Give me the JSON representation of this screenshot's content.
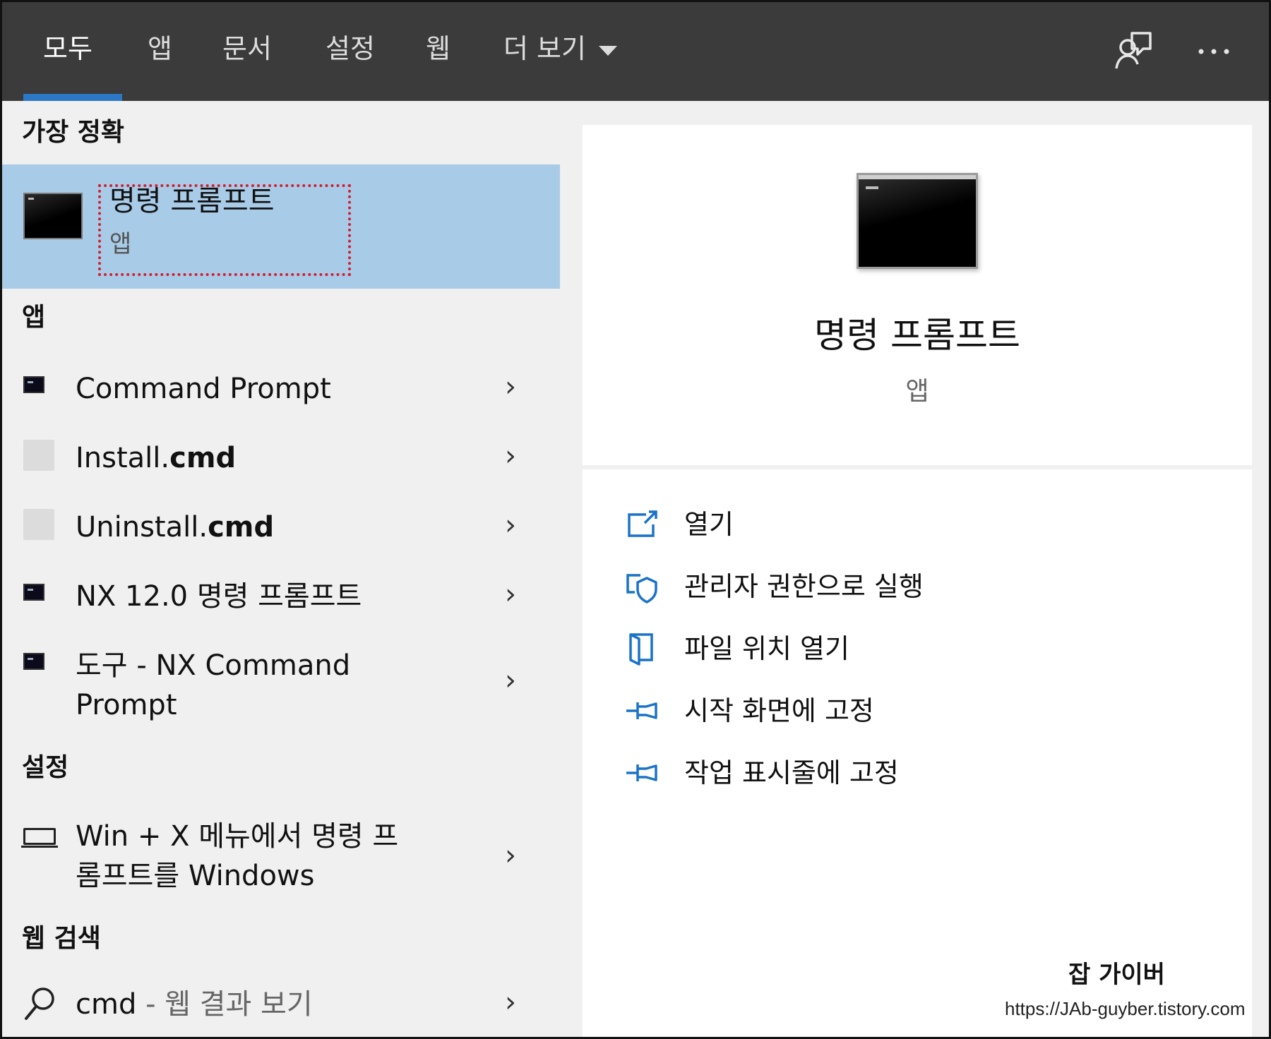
{
  "tabs": [
    {
      "label": "모두",
      "active": true
    },
    {
      "label": "앱"
    },
    {
      "label": "문서"
    },
    {
      "label": "설정"
    },
    {
      "label": "웹"
    },
    {
      "label": "더 보기"
    }
  ],
  "top_icons": [
    "feedback-icon",
    "more-icon"
  ],
  "sections": {
    "best_match": "가장 정확",
    "apps": "앱",
    "settings": "설정",
    "web_search": "웹 검색"
  },
  "best_match": {
    "title": "명령 프롬프트",
    "type": "앱"
  },
  "apps": [
    {
      "label": "Command Prompt",
      "icon": "command-prompt-icon"
    },
    {
      "label_pre": "Install.",
      "label_bold": "cmd",
      "icon": "blank-file-icon"
    },
    {
      "label_pre": "Uninstall.",
      "label_bold": "cmd",
      "icon": "blank-file-icon"
    },
    {
      "label": "NX 12.0 명령 프롬프트",
      "icon": "command-prompt-icon"
    },
    {
      "label_line1": "도구 - NX Command",
      "label_line2": "Prompt",
      "icon": "command-prompt-icon"
    }
  ],
  "settings_items": [
    {
      "label_line1": "Win + X 메뉴에서 명령 프",
      "label_line2": "롬프트를 Windows",
      "icon": "laptop-icon"
    }
  ],
  "web_search": {
    "query": "cmd",
    "suffix": " - 웹 결과 보기",
    "icon": "search-icon"
  },
  "chevron": "›",
  "preview": {
    "title": "명령 프롬프트",
    "type": "앱"
  },
  "actions": [
    {
      "label": "열기",
      "icon": "open-icon"
    },
    {
      "label": "관리자 권한으로 실행",
      "icon": "shield-icon"
    },
    {
      "label": "파일 위치 열기",
      "icon": "file-location-icon"
    },
    {
      "label": "시작 화면에 고정",
      "icon": "pin-icon"
    },
    {
      "label": "작업 표시줄에 고정",
      "icon": "pin-icon"
    }
  ],
  "watermark": {
    "title": "잡 가이버",
    "url": "https://JAb-guyber.tistory.com"
  },
  "colors": {
    "accent": "#2b78c6",
    "topbar": "#3b3b3b",
    "selected": "#a8cbe8",
    "highlight_box": "#d21e2e",
    "icon_blue": "#1a73c8"
  }
}
